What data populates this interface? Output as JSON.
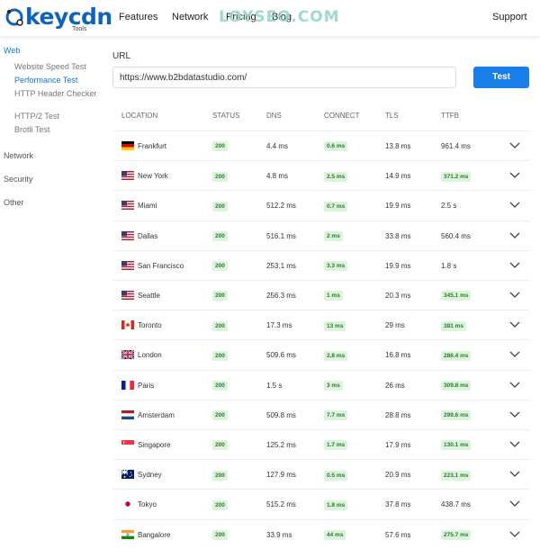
{
  "header": {
    "logo_text": "keycdn",
    "logo_sub": "Tools",
    "nav": [
      "Features",
      "Network",
      "Pricing",
      "Blog"
    ],
    "support": "Support",
    "watermark": "LOYSEO.COM"
  },
  "sidebar": {
    "categories": [
      {
        "label": "Web",
        "active": true
      },
      {
        "label": "Network",
        "active": false
      },
      {
        "label": "Security",
        "active": false
      },
      {
        "label": "Other",
        "active": false
      }
    ],
    "items": [
      {
        "label": "Website Speed Test",
        "active": false
      },
      {
        "label": "Performance Test",
        "active": true
      },
      {
        "label": "HTTP Header Checker",
        "active": false
      },
      {
        "label": "HTTP/2 Test",
        "active": false
      },
      {
        "label": "Brotli Test",
        "active": false
      }
    ]
  },
  "form": {
    "url_label": "URL",
    "url_value": "https://www.b2bdatastudio.com/",
    "test_label": "Test"
  },
  "table": {
    "headers": [
      "LOCATION",
      "STATUS",
      "DNS",
      "CONNECT",
      "TLS",
      "TTFB"
    ],
    "rows": [
      {
        "flag": "de",
        "location": "Frankfurt",
        "status": "200",
        "dns": "4.4 ms",
        "connect": "0.6 ms",
        "tls": "13.8 ms",
        "ttfb": "961.4 ms",
        "ttfb_badge": false
      },
      {
        "flag": "us",
        "location": "New York",
        "status": "200",
        "dns": "4.8 ms",
        "connect": "2.5 ms",
        "tls": "14.9 ms",
        "ttfb": "371.2 ms",
        "ttfb_badge": true
      },
      {
        "flag": "us",
        "location": "Miami",
        "status": "200",
        "dns": "512.2 ms",
        "connect": "0.7 ms",
        "tls": "19.9 ms",
        "ttfb": "2.5 s",
        "ttfb_badge": false
      },
      {
        "flag": "us",
        "location": "Dallas",
        "status": "200",
        "dns": "516.1 ms",
        "connect": "2 ms",
        "tls": "33.8 ms",
        "ttfb": "560.4 ms",
        "ttfb_badge": false
      },
      {
        "flag": "us",
        "location": "San Francisco",
        "status": "200",
        "dns": "253.1 ms",
        "connect": "3.3 ms",
        "tls": "19.9 ms",
        "ttfb": "1.8 s",
        "ttfb_badge": false
      },
      {
        "flag": "us",
        "location": "Seattle",
        "status": "200",
        "dns": "256.3 ms",
        "connect": "1 ms",
        "tls": "20.3 ms",
        "ttfb": "345.1 ms",
        "ttfb_badge": true
      },
      {
        "flag": "ca",
        "location": "Toronto",
        "status": "200",
        "dns": "17.3 ms",
        "connect": "13 ms",
        "tls": "29 ms",
        "ttfb": "381 ms",
        "ttfb_badge": true
      },
      {
        "flag": "gb",
        "location": "London",
        "status": "200",
        "dns": "509.6 ms",
        "connect": "2.8 ms",
        "tls": "16.8 ms",
        "ttfb": "286.4 ms",
        "ttfb_badge": true
      },
      {
        "flag": "fr",
        "location": "Paris",
        "status": "200",
        "dns": "1.5 s",
        "connect": "3 ms",
        "tls": "26 ms",
        "ttfb": "309.8 ms",
        "ttfb_badge": true
      },
      {
        "flag": "nl",
        "location": "Amsterdam",
        "status": "200",
        "dns": "509.8 ms",
        "connect": "7.7 ms",
        "tls": "28.8 ms",
        "ttfb": "299.6 ms",
        "ttfb_badge": true
      },
      {
        "flag": "sg",
        "location": "Singapore",
        "status": "200",
        "dns": "125.2 ms",
        "connect": "1.7 ms",
        "tls": "17.9 ms",
        "ttfb": "130.1 ms",
        "ttfb_badge": true
      },
      {
        "flag": "au",
        "location": "Sydney",
        "status": "200",
        "dns": "127.9 ms",
        "connect": "0.5 ms",
        "tls": "20.9 ms",
        "ttfb": "223.1 ms",
        "ttfb_badge": true
      },
      {
        "flag": "jp",
        "location": "Tokyo",
        "status": "200",
        "dns": "515.2 ms",
        "connect": "1.8 ms",
        "tls": "37.8 ms",
        "ttfb": "438.7 ms",
        "ttfb_badge": false
      },
      {
        "flag": "in",
        "location": "Bangalore",
        "status": "200",
        "dns": "33.9 ms",
        "connect": "44 ms",
        "tls": "57.6 ms",
        "ttfb": "275.7 ms",
        "ttfb_badge": true
      }
    ]
  },
  "colors": {
    "brand": "#0f63b8",
    "accent": "#1a7ee8",
    "badge_bg": "#dcf3dc",
    "badge_text": "#2a7a2a"
  }
}
